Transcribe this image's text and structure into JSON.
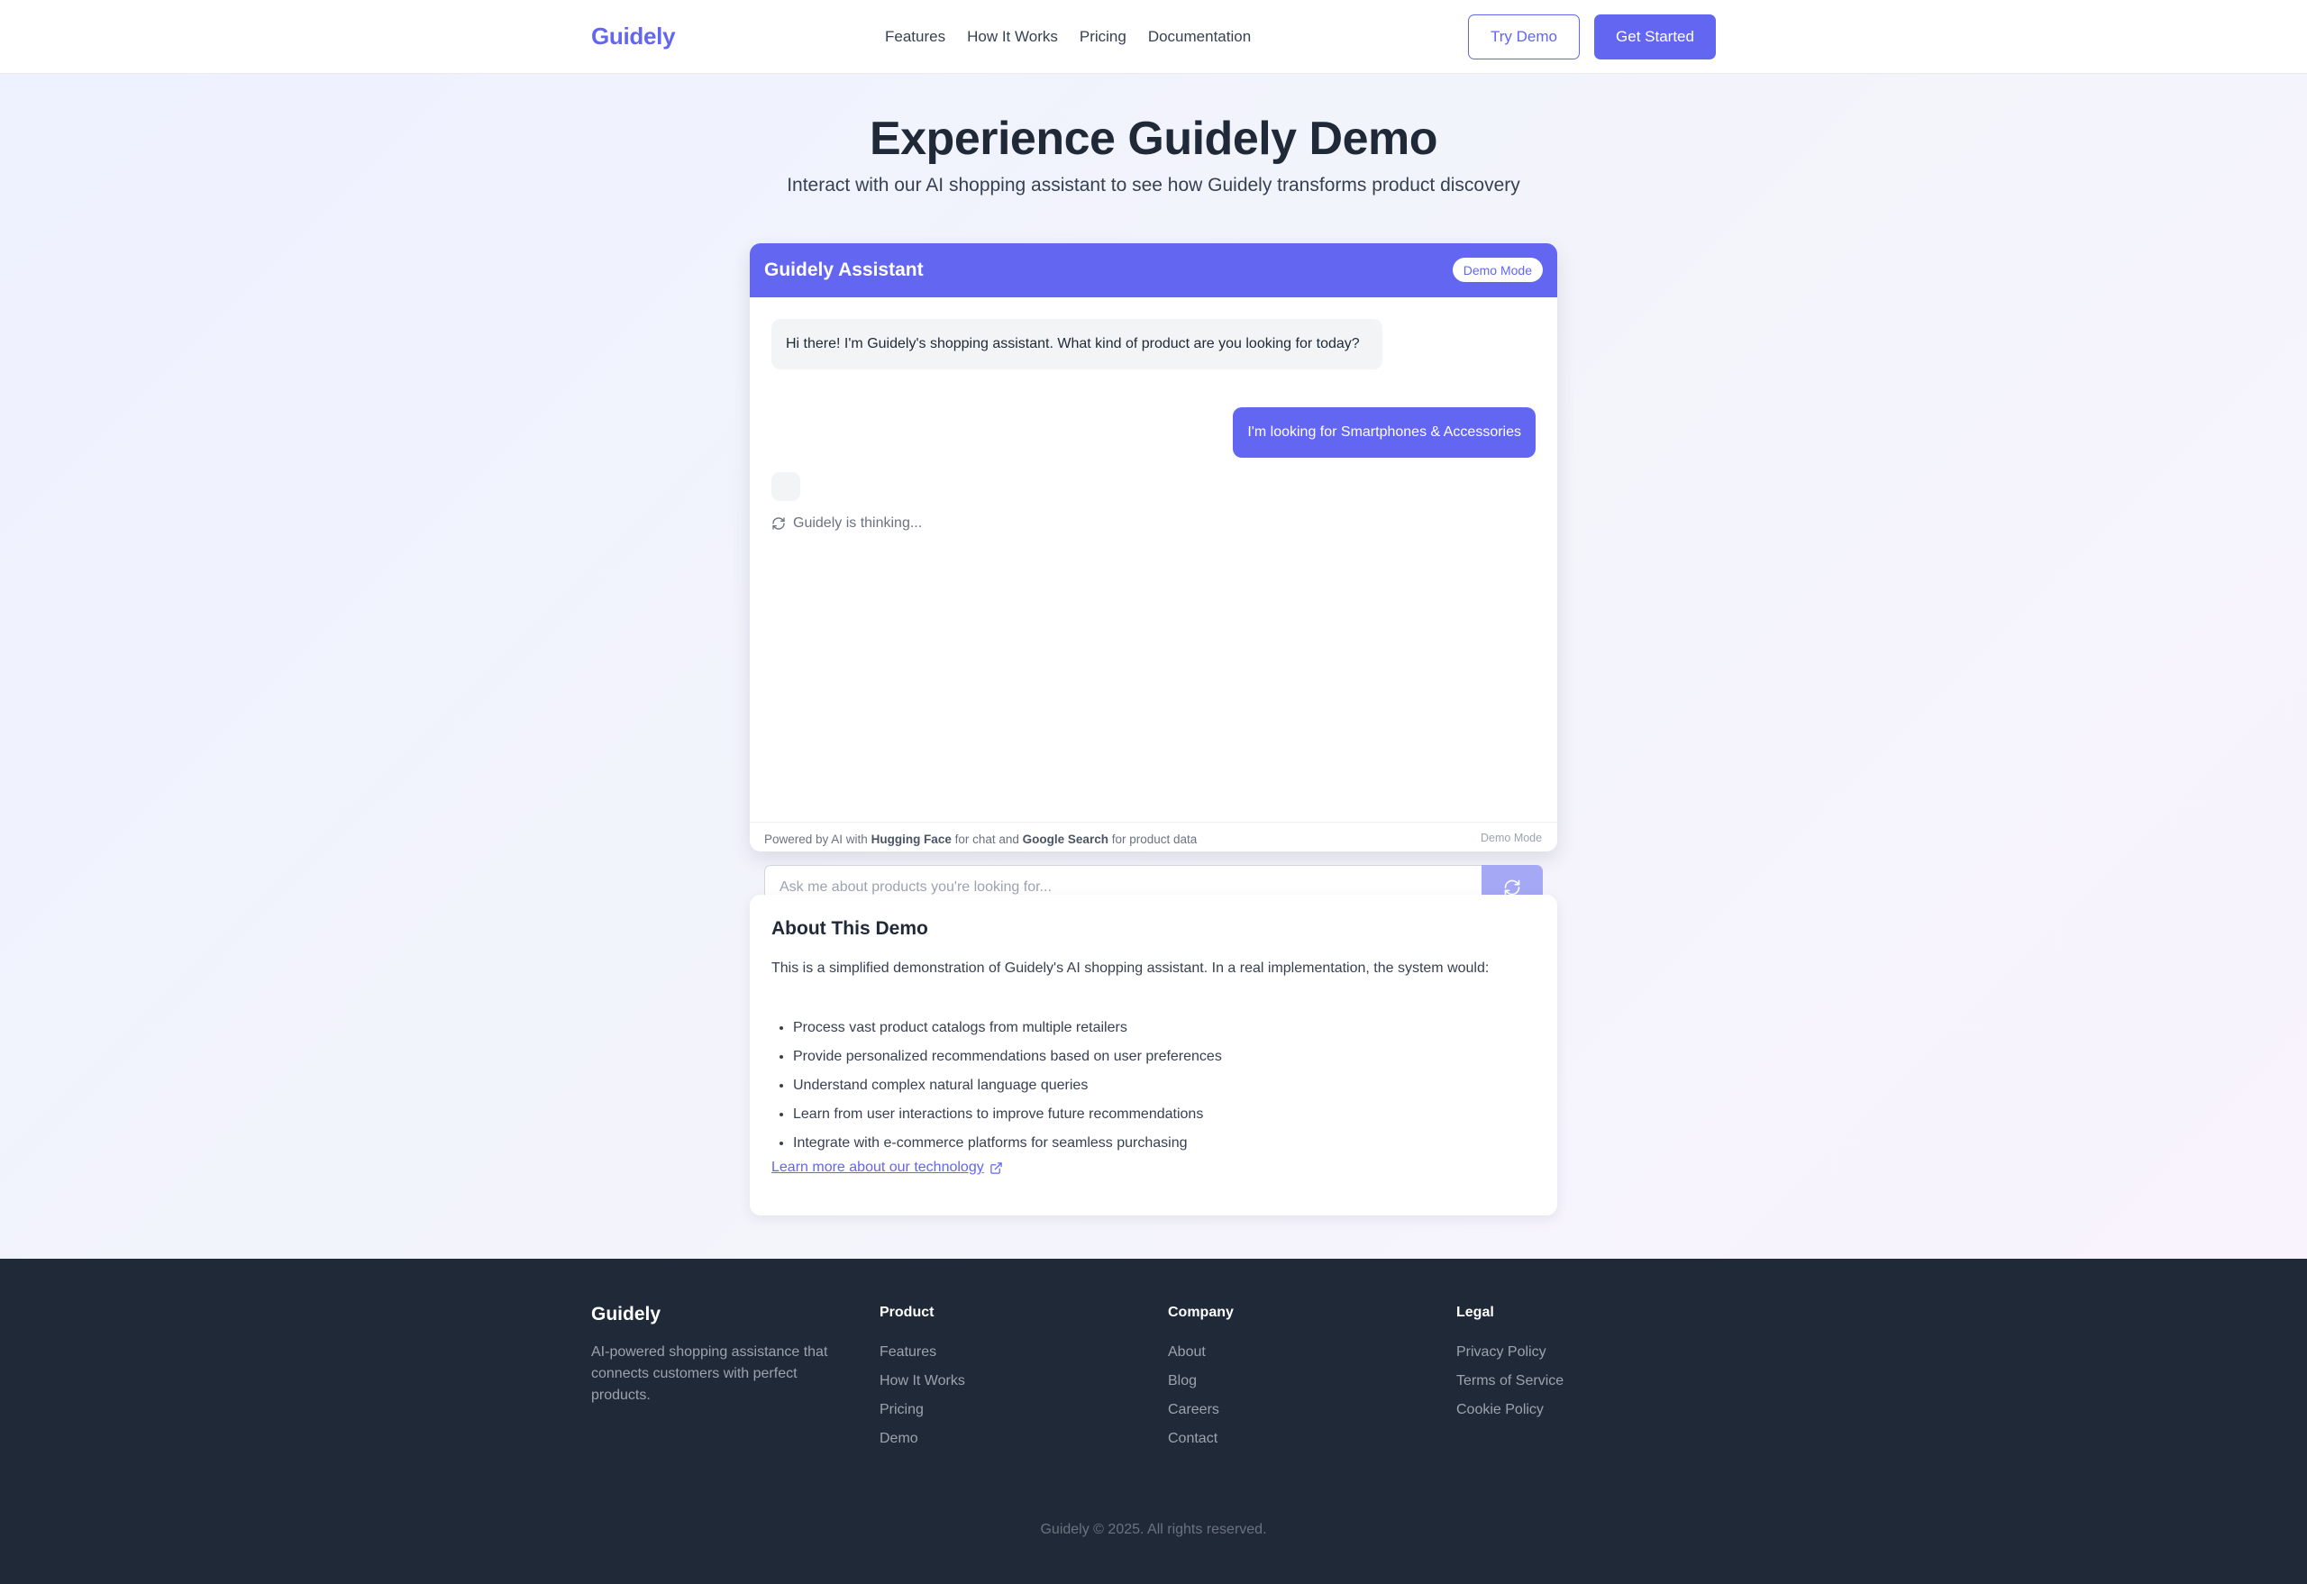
{
  "header": {
    "logo": "Guidely",
    "nav": [
      "Features",
      "How It Works",
      "Pricing",
      "Documentation"
    ],
    "try_demo": "Try Demo",
    "get_started": "Get Started"
  },
  "hero": {
    "title": "Experience Guidely Demo",
    "subtitle": "Interact with our AI shopping assistant to see how Guidely transforms product discovery"
  },
  "chat": {
    "title": "Guidely Assistant",
    "badge": "Demo Mode",
    "bot_message": "Hi there! I'm Guidely's shopping assistant. What kind of product are you looking for today?",
    "user_message": "I'm looking for Smartphones & Accessories",
    "thinking": "Guidely is thinking...",
    "powered_prefix": "Powered by AI with",
    "powered_hf": "Hugging Face",
    "powered_mid": "for chat and",
    "powered_google": "Google Search",
    "powered_suffix": "for product data",
    "footer_mode": "Demo Mode",
    "input_placeholder": "Ask me about products you're looking for...",
    "input_value": ""
  },
  "about": {
    "title": "About This Demo",
    "intro": "This is a simplified demonstration of Guidely's AI shopping assistant. In a real implementation, the system would:",
    "items": [
      "Process vast product catalogs from multiple retailers",
      "Provide personalized recommendations based on user preferences",
      "Understand complex natural language queries",
      "Learn from user interactions to improve future recommendations",
      "Integrate with e-commerce platforms for seamless purchasing"
    ],
    "link": "Learn more about our technology"
  },
  "footer": {
    "brand": "Guidely",
    "tagline": "AI-powered shopping assistance that connects customers with perfect products.",
    "columns": [
      {
        "title": "Product",
        "links": [
          "Features",
          "How It Works",
          "Pricing",
          "Demo"
        ]
      },
      {
        "title": "Company",
        "links": [
          "About",
          "Blog",
          "Careers",
          "Contact"
        ]
      },
      {
        "title": "Legal",
        "links": [
          "Privacy Policy",
          "Terms of Service",
          "Cookie Policy"
        ]
      }
    ],
    "copyright": "Guidely © 2025. All rights reserved."
  },
  "colors": {
    "accent": "#6366f1",
    "footer_bg": "#1f2937",
    "bot_bubble": "#f3f4f6"
  },
  "icons": {
    "thinking": "refresh-icon",
    "send": "refresh-icon",
    "learn_more": "external-link-icon"
  }
}
